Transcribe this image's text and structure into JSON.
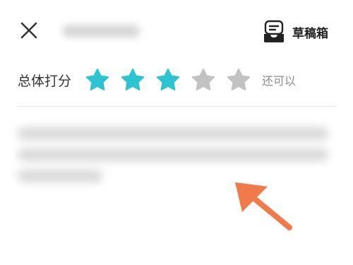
{
  "header": {
    "close_icon": "close-icon",
    "draft_icon": "draft-box-icon",
    "draft_label": "草稿箱"
  },
  "rating": {
    "label": "总体打分",
    "max_stars": 5,
    "value": 3,
    "value_text": "还可以",
    "active_color": "#2bc4d0",
    "inactive_color": "#c2c2c2"
  },
  "annotation": {
    "arrow_color": "#f07a4a",
    "arrow_icon": "arrow-up-left-icon"
  }
}
